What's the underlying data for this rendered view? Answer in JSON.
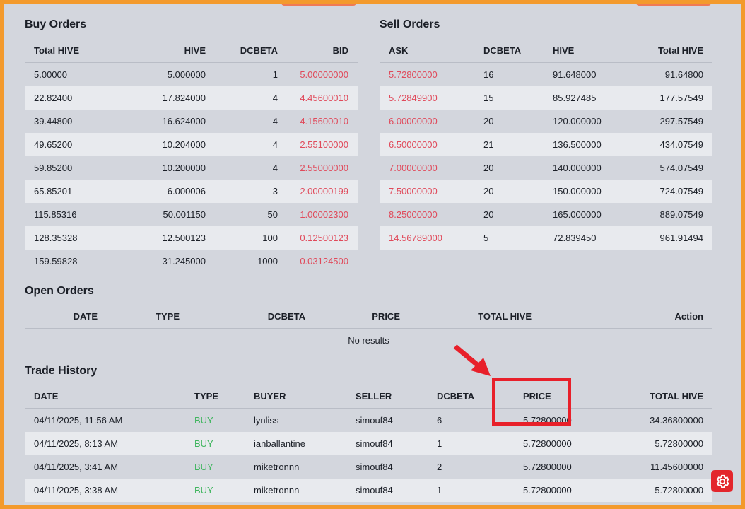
{
  "buy_orders": {
    "title": "Buy Orders",
    "headers": [
      "Total HIVE",
      "HIVE",
      "DCBETA",
      "BID"
    ],
    "rows": [
      [
        "5.00000",
        "5.000000",
        "1",
        "5.00000000"
      ],
      [
        "22.82400",
        "17.824000",
        "4",
        "4.45600010"
      ],
      [
        "39.44800",
        "16.624000",
        "4",
        "4.15600010"
      ],
      [
        "49.65200",
        "10.204000",
        "4",
        "2.55100000"
      ],
      [
        "59.85200",
        "10.200000",
        "4",
        "2.55000000"
      ],
      [
        "65.85201",
        "6.000006",
        "3",
        "2.00000199"
      ],
      [
        "115.85316",
        "50.001150",
        "50",
        "1.00002300"
      ],
      [
        "128.35328",
        "12.500123",
        "100",
        "0.12500123"
      ],
      [
        "159.59828",
        "31.245000",
        "1000",
        "0.03124500"
      ]
    ]
  },
  "sell_orders": {
    "title": "Sell Orders",
    "headers": [
      "ASK",
      "DCBETA",
      "HIVE",
      "Total HIVE"
    ],
    "rows": [
      [
        "5.72800000",
        "16",
        "91.648000",
        "91.64800"
      ],
      [
        "5.72849900",
        "15",
        "85.927485",
        "177.57549"
      ],
      [
        "6.00000000",
        "20",
        "120.000000",
        "297.57549"
      ],
      [
        "6.50000000",
        "21",
        "136.500000",
        "434.07549"
      ],
      [
        "7.00000000",
        "20",
        "140.000000",
        "574.07549"
      ],
      [
        "7.50000000",
        "20",
        "150.000000",
        "724.07549"
      ],
      [
        "8.25000000",
        "20",
        "165.000000",
        "889.07549"
      ],
      [
        "14.56789000",
        "5",
        "72.839450",
        "961.91494"
      ]
    ]
  },
  "open_orders": {
    "title": "Open Orders",
    "headers": [
      "DATE",
      "TYPE",
      "DCBETA",
      "PRICE",
      "TOTAL HIVE",
      "Action"
    ],
    "empty_text": "No results"
  },
  "trade_history": {
    "title": "Trade History",
    "headers": [
      "DATE",
      "TYPE",
      "BUYER",
      "SELLER",
      "DCBETA",
      "PRICE",
      "TOTAL HIVE"
    ],
    "rows": [
      [
        "04/11/2025, 11:56 AM",
        "BUY",
        "lynliss",
        "simouf84",
        "6",
        "5.72800000",
        "34.36800000"
      ],
      [
        "04/11/2025, 8:13 AM",
        "BUY",
        "ianballantine",
        "simouf84",
        "1",
        "5.72800000",
        "5.72800000"
      ],
      [
        "04/11/2025, 3:41 AM",
        "BUY",
        "miketronnn",
        "simouf84",
        "2",
        "5.72800000",
        "11.45600000"
      ],
      [
        "04/11/2025, 3:38 AM",
        "BUY",
        "miketronnn",
        "simouf84",
        "1",
        "5.72800000",
        "5.72800000"
      ]
    ]
  },
  "colors": {
    "frame": "#f39a2c",
    "background": "#d3d6dd",
    "ask_bid": "#e04a5b",
    "buy": "#3fb55e",
    "annotation": "#e8202a"
  },
  "icons": {
    "settings": "gear-icon",
    "annotation_arrow": "red-arrow-icon"
  }
}
